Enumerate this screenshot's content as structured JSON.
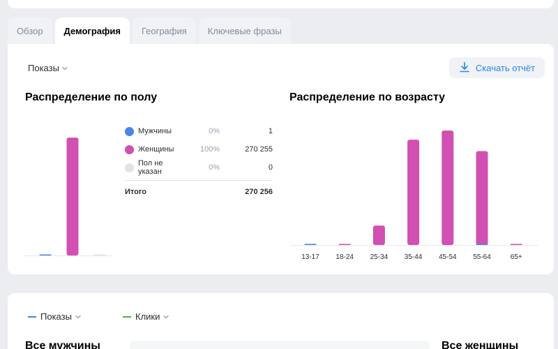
{
  "tabs": [
    {
      "label": "Обзор",
      "active": false
    },
    {
      "label": "Демография",
      "active": true
    },
    {
      "label": "География",
      "active": false
    },
    {
      "label": "Ключевые фразы",
      "active": false
    }
  ],
  "metric_select": {
    "label": "Показы"
  },
  "download": {
    "label": "Скачать отчёт"
  },
  "gender": {
    "title": "Распределение по полу",
    "legend": [
      {
        "name": "Мужчины",
        "percent": "0%",
        "value": "1",
        "color": "#4a86e8"
      },
      {
        "name": "Женщины",
        "percent": "100%",
        "value": "270 255",
        "color": "#d250b1"
      },
      {
        "name": "Пол не указан",
        "percent": "0%",
        "value": "0",
        "color": "#e1e3e6"
      }
    ],
    "total": {
      "label": "Итого",
      "value": "270 256"
    }
  },
  "age": {
    "title": "Распределение по возрасту"
  },
  "bottom": {
    "metric1": "Показы",
    "metric2": "Клики",
    "metric1_color": "#3f8ae0",
    "metric2_color": "#4bb34b",
    "left_title": "Все мужчины",
    "right_title": "Все женщины"
  },
  "chart_data": [
    {
      "type": "bar",
      "categories": [
        "Мужчины",
        "Женщины",
        "Пол не указан"
      ],
      "values": [
        1,
        270255,
        0
      ],
      "colors": [
        "#4a86e8",
        "#d250b1",
        "#e1e3e6"
      ],
      "ylim": [
        0,
        280000
      ],
      "grid": false,
      "title": "Распределение по полу"
    },
    {
      "type": "bar",
      "categories": [
        "13-17",
        "18-24",
        "25-34",
        "35-44",
        "45-54",
        "55-64",
        "65+"
      ],
      "series": [
        {
          "values": [
            0,
            0.2,
            17,
            92,
            100,
            82,
            0.5
          ],
          "color": "#d250b1"
        },
        {
          "values": [
            1,
            0,
            0,
            0,
            0,
            0.5,
            0
          ],
          "color": "#4a86e8"
        }
      ],
      "ylim": [
        0,
        100
      ],
      "grid": false,
      "title": "Распределение по возрасту"
    }
  ]
}
